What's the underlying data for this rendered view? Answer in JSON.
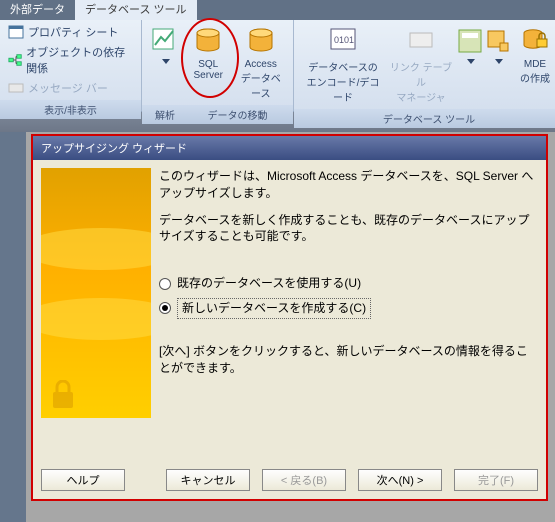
{
  "tabs": {
    "external": "外部データ",
    "dbtools": "データベース ツール"
  },
  "ribbon": {
    "group1": {
      "prop_sheet": "プロパティ シート",
      "dependencies": "オブジェクトの依存関係",
      "msg_bar": "メッセージ バー",
      "label": "表示/非表示"
    },
    "group2": {
      "analyze": "解析",
      "sql_server": "SQL\nServer",
      "access_db": "Access\nデータベース",
      "label": "データの移動"
    },
    "group3": {
      "encode": "データベースの\nエンコード/デコード",
      "link_mgr": "リンク テーブル\nマネージャ",
      "switchboard": "",
      "addins": "",
      "mde": "MDE\nの作成",
      "label": "データベース ツール"
    }
  },
  "graybar": {
    "label": "«"
  },
  "dialog": {
    "title": "アップサイジング ウィザード",
    "intro1": "このウィザードは、Microsoft Access データベースを、SQL Server へアップサイズします。",
    "intro2": "データベースを新しく作成することも、既存のデータベースにアップサイズすることも可能です。",
    "radio1": "既存のデータベースを使用する(U)",
    "radio2": "新しいデータベースを作成する(C)",
    "hint": "[次へ] ボタンをクリックすると、新しいデータベースの情報を得ることができます。",
    "buttons": {
      "help": "ヘルプ",
      "cancel": "キャンセル",
      "back": "< 戻る(B)",
      "next": "次へ(N) >",
      "finish": "完了(F)"
    }
  }
}
